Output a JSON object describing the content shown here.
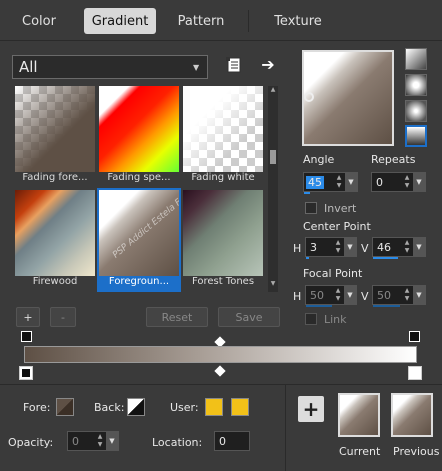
{
  "tabs": [
    {
      "label": "Color",
      "active": false
    },
    {
      "label": "Gradient",
      "active": true
    },
    {
      "label": "Pattern",
      "active": false
    },
    {
      "label": "Texture",
      "active": false
    }
  ],
  "category": {
    "value": "All"
  },
  "gradients": [
    {
      "label": "Fading fore...",
      "selected": false
    },
    {
      "label": "Fading spe...",
      "selected": false
    },
    {
      "label": "Fading white",
      "selected": false
    },
    {
      "label": "Firewood",
      "selected": false
    },
    {
      "label": "Foregroun...",
      "selected": true
    },
    {
      "label": "Forest Tones",
      "selected": false
    }
  ],
  "watermark": "PSP Addict Estela Fonseca",
  "list_buttons": {
    "add": "+",
    "remove": "-",
    "reset": "Reset",
    "save": "Save"
  },
  "angle": {
    "label": "Angle",
    "value": "45"
  },
  "repeats": {
    "label": "Repeats",
    "value": "0"
  },
  "invert": {
    "label": "Invert",
    "checked": false
  },
  "center_point": {
    "label": "Center Point",
    "h_label": "H",
    "h": "3",
    "v_label": "V",
    "v": "46"
  },
  "focal_point": {
    "label": "Focal Point",
    "h_label": "H",
    "h": "50",
    "v_label": "V",
    "v": "50"
  },
  "link": {
    "label": "Link",
    "checked": false
  },
  "bottom": {
    "fore_label": "Fore:",
    "back_label": "Back:",
    "user_label": "User:",
    "opacity_label": "Opacity:",
    "opacity_value": "0",
    "location_label": "Location:",
    "location_value": "0",
    "add_label": "+",
    "current_label": "Current",
    "previous_label": "Previous"
  },
  "colors": {
    "gradient_dark": "#5e5045",
    "gradient_light": "#ffffff",
    "user_swatch": "#f2c118",
    "accent": "#1c6fc9"
  }
}
